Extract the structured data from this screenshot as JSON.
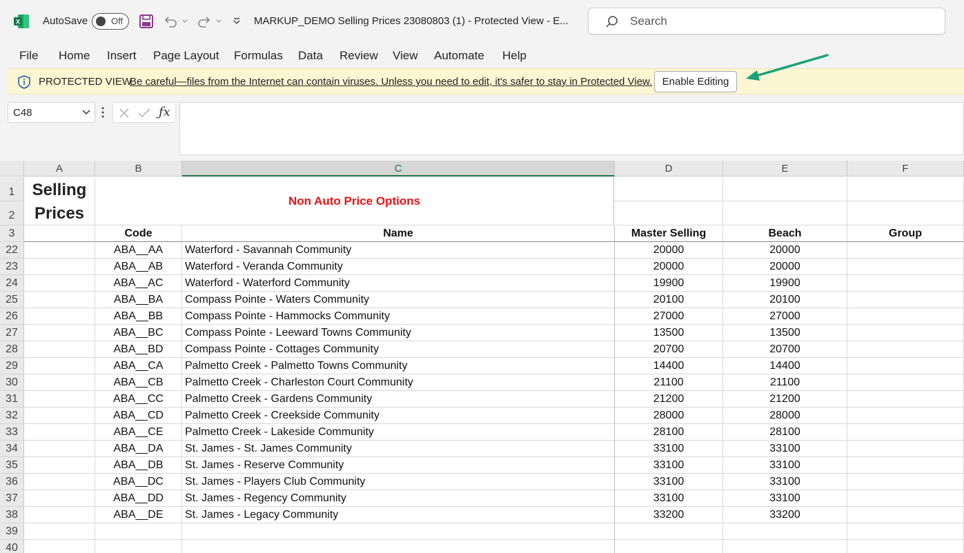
{
  "titlebar": {
    "autosave_label": "AutoSave",
    "autosave_state": "Off",
    "document_title": "MARKUP_DEMO Selling Prices 23080803 (1)  -  Protected View  -  E...",
    "search_placeholder": "Search"
  },
  "menu": {
    "items": [
      "File",
      "Home",
      "Insert",
      "Page Layout",
      "Formulas",
      "Data",
      "Review",
      "View",
      "Automate",
      "Help"
    ]
  },
  "protected_view": {
    "title": "PROTECTED VIEW",
    "message": "Be careful—files from the Internet can contain viruses. Unless you need to edit, it's safer to stay in Protected View.",
    "button": "Enable Editing",
    "arrow_color": "#1aa07a"
  },
  "formula_bar": {
    "name_box": "C48",
    "formula": ""
  },
  "sheet": {
    "columns": [
      "A",
      "B",
      "C",
      "D",
      "E",
      "F"
    ],
    "selected_column": "C",
    "title_text": "Selling Prices",
    "merged_title": "Non Auto Price Options",
    "merged_title_color": "#ee1111",
    "header_row_number": "3",
    "header_cells": [
      "",
      "Code",
      "Name",
      "Master Selling",
      "Beach",
      "Group"
    ],
    "top_row_numbers": [
      "1",
      "2"
    ],
    "rows": [
      {
        "num": "22",
        "code": "ABA__AA",
        "name": "Waterford - Savannah Community",
        "master": "20000",
        "beach": "20000"
      },
      {
        "num": "23",
        "code": "ABA__AB",
        "name": "Waterford - Veranda Community",
        "master": "20000",
        "beach": "20000"
      },
      {
        "num": "24",
        "code": "ABA__AC",
        "name": "Waterford - Waterford Community",
        "master": "19900",
        "beach": "19900"
      },
      {
        "num": "25",
        "code": "ABA__BA",
        "name": "Compass Pointe - Waters Community",
        "master": "20100",
        "beach": "20100"
      },
      {
        "num": "26",
        "code": "ABA__BB",
        "name": "Compass Pointe - Hammocks Community",
        "master": "27000",
        "beach": "27000"
      },
      {
        "num": "27",
        "code": "ABA__BC",
        "name": "Compass Pointe - Leeward Towns Community",
        "master": "13500",
        "beach": "13500"
      },
      {
        "num": "28",
        "code": "ABA__BD",
        "name": "Compass Pointe - Cottages Community",
        "master": "20700",
        "beach": "20700"
      },
      {
        "num": "29",
        "code": "ABA__CA",
        "name": "Palmetto Creek - Palmetto Towns Community",
        "master": "14400",
        "beach": "14400"
      },
      {
        "num": "30",
        "code": "ABA__CB",
        "name": "Palmetto Creek - Charleston Court Community",
        "master": "21100",
        "beach": "21100"
      },
      {
        "num": "31",
        "code": "ABA__CC",
        "name": "Palmetto Creek - Gardens Community",
        "master": "21200",
        "beach": "21200"
      },
      {
        "num": "32",
        "code": "ABA__CD",
        "name": "Palmetto Creek - Creekside Community",
        "master": "28000",
        "beach": "28000"
      },
      {
        "num": "33",
        "code": "ABA__CE",
        "name": "Palmetto Creek - Lakeside Community",
        "master": "28100",
        "beach": "28100"
      },
      {
        "num": "34",
        "code": "ABA__DA",
        "name": "St. James - St. James Community",
        "master": "33100",
        "beach": "33100"
      },
      {
        "num": "35",
        "code": "ABA__DB",
        "name": "St. James - Reserve Community",
        "master": "33100",
        "beach": "33100"
      },
      {
        "num": "36",
        "code": "ABA__DC",
        "name": "St. James - Players Club Community",
        "master": "33100",
        "beach": "33100"
      },
      {
        "num": "37",
        "code": "ABA__DD",
        "name": "St. James - Regency Community",
        "master": "33100",
        "beach": "33100"
      },
      {
        "num": "38",
        "code": "ABA__DE",
        "name": "St. James - Legacy Community",
        "master": "33200",
        "beach": "33200"
      },
      {
        "num": "39",
        "code": "",
        "name": "",
        "master": "",
        "beach": ""
      },
      {
        "num": "40",
        "code": "",
        "name": "",
        "master": "",
        "beach": ""
      }
    ]
  }
}
